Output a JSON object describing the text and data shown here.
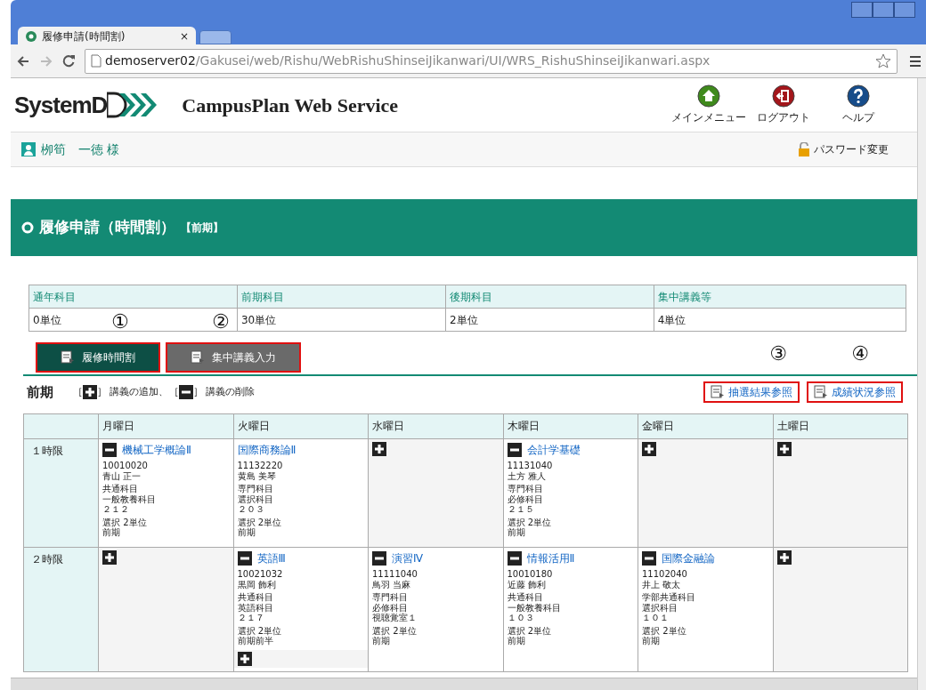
{
  "browser": {
    "tab_title": "履修申請(時間割)",
    "tab_close": "×",
    "url_host": "demoserver02",
    "url_path": "/Gakusei/web/Rishu/WebRishuShinseiJikanwari/UI/WRS_RishuShinseiJikanwari.aspx"
  },
  "header": {
    "logo": "SystemD",
    "title": "CampusPlan Web Service",
    "nav": [
      {
        "kind": "home",
        "label": "メインメニュー",
        "color": "#3f8a1c"
      },
      {
        "kind": "logout",
        "label": "ログアウト",
        "color": "#a3161b"
      },
      {
        "kind": "help",
        "label": "ヘルプ",
        "color": "#164c8a"
      }
    ]
  },
  "user": {
    "name": "栁筍　一徳 様",
    "password_link": "パスワード変更"
  },
  "page_title": "履修申請（時間割）",
  "term_badge": "【前期】",
  "summary": {
    "columns": [
      "通年科目",
      "前期科目",
      "後期科目",
      "集中講義等"
    ],
    "values": [
      "0単位",
      "30単位",
      "2単位",
      "4単位"
    ]
  },
  "tabs": [
    {
      "label": "履修時間割",
      "selected": true,
      "highlighted": true,
      "annotation": "①"
    },
    {
      "label": "集中講義入力",
      "selected": false,
      "highlighted": true,
      "annotation": "②"
    }
  ],
  "term_label": "前期",
  "legend": [
    {
      "before": "［",
      "kind": "add",
      "after": "］ 講義の追加、"
    },
    {
      "before": "［",
      "kind": "remove",
      "after": "］ 講義の削除"
    }
  ],
  "actions": [
    {
      "label": "抽選結果参照",
      "highlighted": true,
      "annotation": "③"
    },
    {
      "label": "成績状況参照",
      "highlighted": true,
      "annotation": "④"
    }
  ],
  "timetable": {
    "days": [
      "月曜日",
      "火曜日",
      "水曜日",
      "木曜日",
      "金曜日",
      "土曜日"
    ],
    "periods": [
      {
        "label": "１時限",
        "cells": [
          {
            "kind": "course",
            "removable": true,
            "addable": false,
            "title": "機械工学概論Ⅱ",
            "code": "10010020",
            "teacher": "青山 正一",
            "categories": [
              "共通科目",
              "一般教養科目"
            ],
            "room": "２１２",
            "credit": "選択 2単位",
            "term": "前期"
          },
          {
            "kind": "course",
            "removable": false,
            "addable": false,
            "title": "国際商務論Ⅱ",
            "code": "11132220",
            "teacher": "黄島 美琴",
            "categories": [
              "専門科目",
              "選択科目"
            ],
            "room": "２０３",
            "credit": "選択 2単位",
            "term": "前期"
          },
          {
            "kind": "empty"
          },
          {
            "kind": "course",
            "removable": true,
            "addable": false,
            "title": "会計学基礎",
            "code": "11131040",
            "teacher": "土方 雅人",
            "categories": [
              "専門科目",
              "必修科目"
            ],
            "room": "２１５",
            "credit": "選択 2単位",
            "term": "前期"
          },
          {
            "kind": "empty"
          },
          {
            "kind": "empty"
          }
        ]
      },
      {
        "label": "２時限",
        "cells": [
          {
            "kind": "empty"
          },
          {
            "kind": "course",
            "removable": true,
            "addable": true,
            "title": "英語Ⅲ",
            "code": "10021032",
            "teacher": "黒岡 飾利",
            "categories": [
              "共通科目",
              "英語科目"
            ],
            "room": "２１７",
            "credit": "選択 2単位",
            "term": "前期前半"
          },
          {
            "kind": "course",
            "removable": true,
            "addable": false,
            "title": "演習Ⅳ",
            "code": "11111040",
            "teacher": "鳥羽 当麻",
            "categories": [
              "専門科目",
              "必修科目"
            ],
            "room": "視聴覚室１",
            "credit": "選択 2単位",
            "term": "前期"
          },
          {
            "kind": "course",
            "removable": true,
            "addable": false,
            "title": "情報活用Ⅱ",
            "code": "10010180",
            "teacher": "近藤 飾利",
            "categories": [
              "共通科目",
              "一般教養科目"
            ],
            "room": "１０３",
            "credit": "選択 2単位",
            "term": "前期"
          },
          {
            "kind": "course",
            "removable": true,
            "addable": false,
            "title": "国際金融論",
            "code": "11102040",
            "teacher": "井上 敬太",
            "categories": [
              "学部共通科目",
              "選択科目"
            ],
            "room": "１０１",
            "credit": "選択 2単位",
            "term": "前期"
          },
          {
            "kind": "empty"
          }
        ]
      }
    ]
  }
}
